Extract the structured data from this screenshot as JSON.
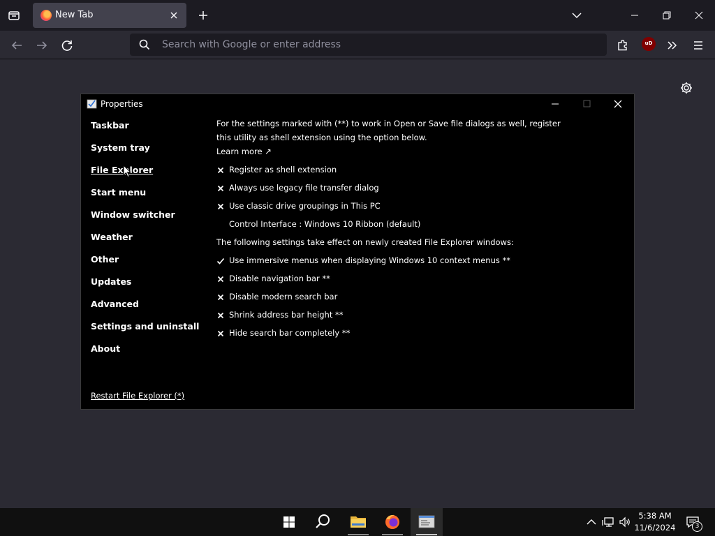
{
  "browser": {
    "tab": {
      "title": "New Tab"
    },
    "urlbar": {
      "placeholder": "Search with Google or enter address"
    },
    "ublock_badge": "uD",
    "colors": {
      "chrome_dark": "#1c1b22",
      "chrome": "#2b2a33",
      "tab_active": "#42414d"
    }
  },
  "properties_window": {
    "title": "Properties",
    "sidebar": [
      {
        "label": "Taskbar"
      },
      {
        "label": "System tray"
      },
      {
        "label": "File Explorer",
        "active": true
      },
      {
        "label": "Start menu"
      },
      {
        "label": "Window switcher"
      },
      {
        "label": "Weather"
      },
      {
        "label": "Other"
      },
      {
        "label": "Updates"
      },
      {
        "label": "Advanced"
      },
      {
        "label": "Settings and uninstall"
      },
      {
        "label": "About"
      }
    ],
    "restart_link": "Restart File Explorer (*)",
    "intro_line1": "For the settings marked with (**) to work in Open or Save file dialogs as well, register",
    "intro_line2": "this utility as shell extension using the option below.",
    "learn_more": "Learn more ↗",
    "options_a": [
      {
        "label": "Register as shell extension",
        "checked": false
      },
      {
        "label": "Always use legacy file transfer dialog",
        "checked": false
      },
      {
        "label": "Use classic drive groupings in This PC",
        "checked": false
      }
    ],
    "control_interface": "Control Interface : Windows 10 Ribbon (default)",
    "section_note": "The following settings take effect on newly created File Explorer windows:",
    "options_b": [
      {
        "label": "Use immersive menus when displaying Windows 10 context menus **",
        "checked": true
      },
      {
        "label": "Disable navigation bar **",
        "checked": false
      },
      {
        "label": "Disable modern search bar",
        "checked": false
      },
      {
        "label": "Shrink address bar height **",
        "checked": false
      },
      {
        "label": "Hide search bar completely **",
        "checked": false
      }
    ]
  },
  "taskbar": {
    "time": "5:38 AM",
    "date": "11/6/2024",
    "notification_count": "3",
    "icons": [
      "windows-start-icon",
      "search-icon",
      "file-explorer-icon",
      "firefox-icon",
      "properties-app-icon"
    ]
  }
}
